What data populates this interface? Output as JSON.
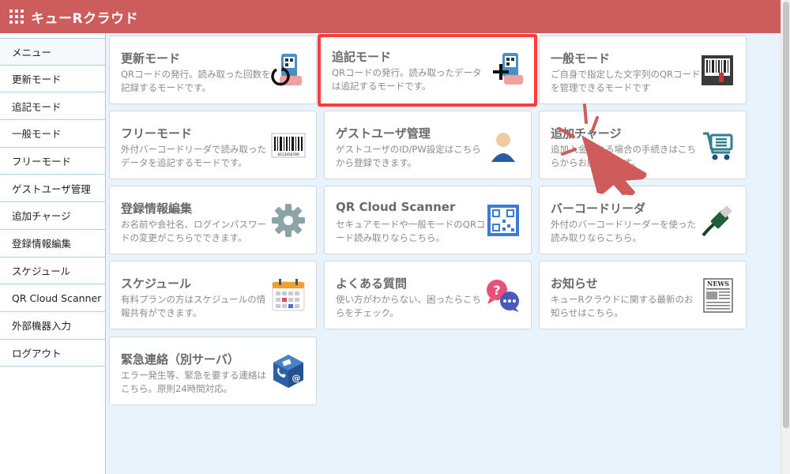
{
  "header": {
    "title": "キューRクラウド"
  },
  "sidebar": {
    "items": [
      {
        "label": "メニュー"
      },
      {
        "label": "更新モード"
      },
      {
        "label": "追記モード"
      },
      {
        "label": "一般モード"
      },
      {
        "label": "フリーモード"
      },
      {
        "label": "ゲストユーザ管理"
      },
      {
        "label": "追加チャージ"
      },
      {
        "label": "登録情報編集"
      },
      {
        "label": "スケジュール"
      },
      {
        "label": "QR Cloud Scanner"
      },
      {
        "label": "外部機器入力"
      },
      {
        "label": "ログアウト"
      }
    ]
  },
  "cards": [
    {
      "title": "更新モード",
      "desc": "QRコードの発行。読み取った回数を記録するモードです。",
      "icon": "qr-phone-refresh-icon"
    },
    {
      "title": "追記モード",
      "desc": "QRコードの発行。読み取ったデータは追記するモードです。",
      "icon": "qr-phone-plus-icon"
    },
    {
      "title": "一般モード",
      "desc": "ご自身で指定した文字列のQRコードを管理できるモードです",
      "icon": "barcode-card-icon"
    },
    {
      "title": "フリーモード",
      "desc": "外付バーコードリーダで読み取ったデータを追記するモードです。",
      "icon": "barcode-icon"
    },
    {
      "title": "ゲストユーザ管理",
      "desc": "ゲストユーザのID/PW設定はこちらから登録できます。",
      "icon": "guest-user-icon"
    },
    {
      "title": "追加チャージ",
      "desc": "追加入金される場合の手続きはこちらからお願いします。",
      "icon": "cart-icon"
    },
    {
      "title": "登録情報編集",
      "desc": "お名前や会社名、ログインパスワードの変更がこちらでできます。",
      "icon": "gear-icon"
    },
    {
      "title": "QR Cloud Scanner",
      "desc": "セキュアモードや一般モードのQRコード読み取りならこちら。",
      "icon": "qr-scan-icon"
    },
    {
      "title": "バーコードリーダ",
      "desc": "外付のバーコードリーダーを使った読み取りならこちら。",
      "icon": "usb-plug-icon"
    },
    {
      "title": "スケジュール",
      "desc": "有料プランの方はスケジュールの情報共有ができます。",
      "icon": "calendar-icon"
    },
    {
      "title": "よくある質問",
      "desc": "使い方がわからない、困ったらこちらをチェック。",
      "icon": "faq-bubble-icon"
    },
    {
      "title": "お知らせ",
      "desc": "キューRクラウドに関する最新のお知らせはこちら。",
      "icon": "newspaper-icon"
    },
    {
      "title": "緊急連絡（別サーバ）",
      "desc": "エラー発生等、緊急を要する連絡はこちら。原則24時間対応。",
      "icon": "contact-cube-icon"
    }
  ],
  "icon_text": {
    "news": "NEWS",
    "barcode_digits": "0123456789"
  },
  "colors": {
    "header": "#cd5c5c",
    "highlight": "#ff3b3b",
    "main_bg": "#e9f3fb",
    "pointer": "#cf5b5b"
  }
}
